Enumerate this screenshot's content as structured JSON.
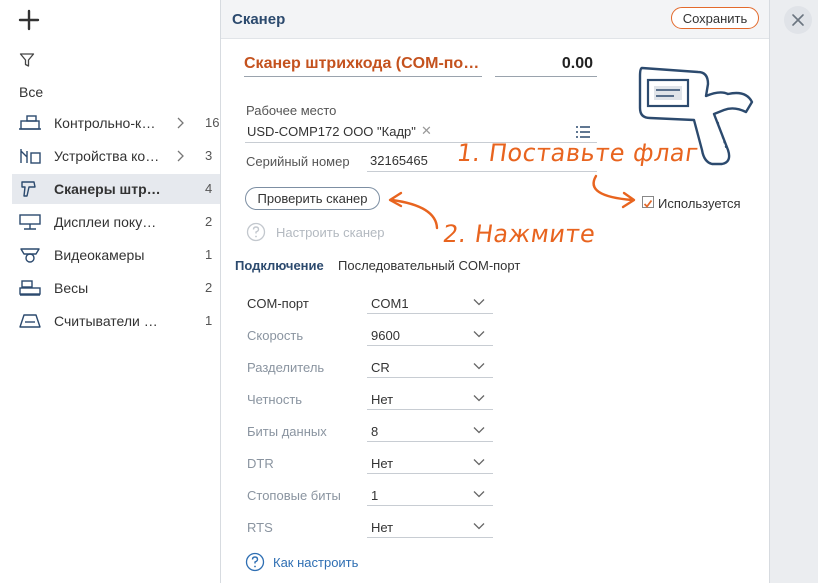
{
  "sidebar": {
    "all_label": "Все",
    "items": [
      {
        "label": "Контрольно-кассовая техника",
        "count": "16",
        "chevron": true,
        "icon": "cash-register-icon"
      },
      {
        "label": "Устройства компании",
        "count": "3",
        "chevron": true,
        "icon": "devices-icon"
      },
      {
        "label": "Сканеры штрихкода",
        "count": "4",
        "chevron": false,
        "icon": "barcode-scanner-icon",
        "active": true
      },
      {
        "label": "Дисплеи покупателя",
        "count": "2",
        "chevron": false,
        "icon": "customer-display-icon"
      },
      {
        "label": "Видеокамеры",
        "count": "1",
        "chevron": false,
        "icon": "video-camera-icon"
      },
      {
        "label": "Весы",
        "count": "2",
        "chevron": false,
        "icon": "scales-icon"
      },
      {
        "label": "Считыватели карт",
        "count": "1",
        "chevron": false,
        "icon": "card-reader-icon"
      }
    ]
  },
  "panel": {
    "title": "Сканер",
    "save_label": "Сохранить",
    "device_name": "Сканер штрихкода (COM-порт)",
    "amount": "0.00",
    "workplace_caption": "Рабочее место",
    "workplace_value": "USD-COMP172  ООО \"Кадр\"",
    "serial_label": "Серийный номер",
    "serial_value": "32165465",
    "check_button": "Проверить сканер",
    "config_scanner": "Настроить сканер",
    "used_label": "Используется",
    "used_checked": true,
    "connection_label": "Подключение",
    "connection_value": "Последовательный COM-порт",
    "params": [
      {
        "label": "COM-порт",
        "value": "COM1",
        "emphasis": true
      },
      {
        "label": "Скорость",
        "value": "9600",
        "emphasis": false
      },
      {
        "label": "Разделитель",
        "value": "CR",
        "emphasis": false
      },
      {
        "label": "Четность",
        "value": "Нет",
        "emphasis": false
      },
      {
        "label": "Биты данных",
        "value": "8",
        "emphasis": false
      },
      {
        "label": "DTR",
        "value": "Нет",
        "emphasis": false
      },
      {
        "label": "Стоповые биты",
        "value": "1",
        "emphasis": false
      },
      {
        "label": "RTS",
        "value": "Нет",
        "emphasis": false
      }
    ],
    "howto_label": "Как настроить"
  },
  "annotations": {
    "step1": "1. Поставьте флаг",
    "step2": "2. Нажмите",
    "color": "#e8641f"
  },
  "colors": {
    "accent": "#e36a2c",
    "title": "#2c4a6e",
    "link": "#2f6fb3",
    "active_row": "#e6e9ee"
  }
}
